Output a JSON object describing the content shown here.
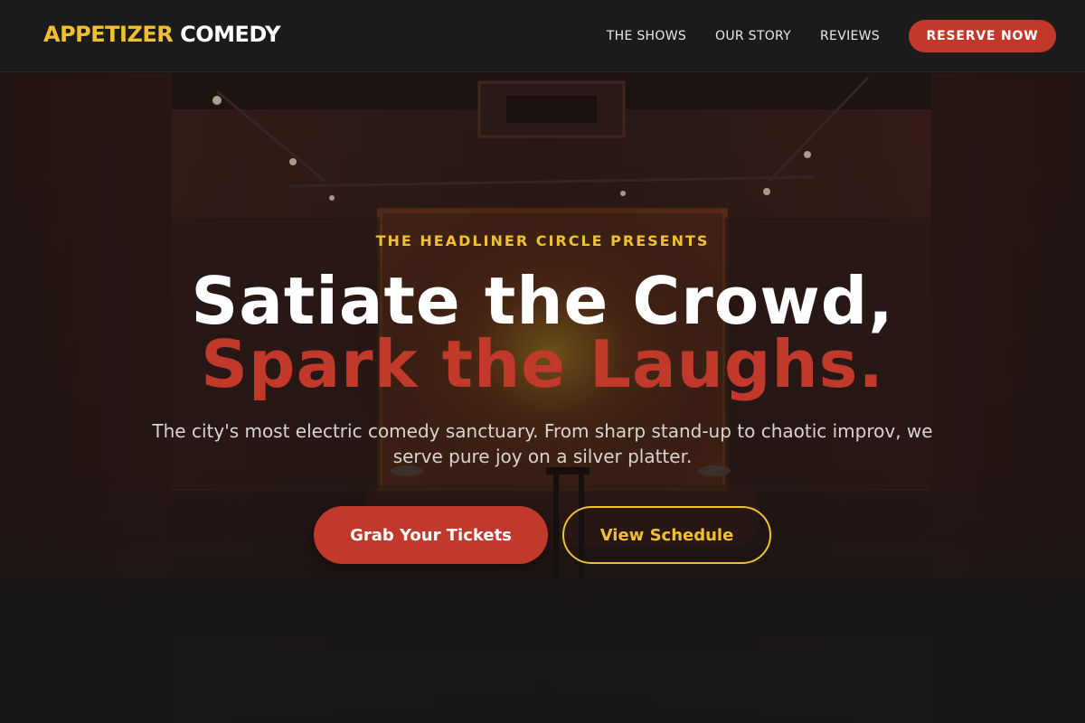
{
  "header": {
    "logo_part1": "APPETIZER",
    "logo_part2": "COMEDY",
    "nav": [
      "THE SHOWS",
      "OUR STORY",
      "REVIEWS"
    ],
    "cta": "RESERVE NOW"
  },
  "hero": {
    "eyebrow": "THE HEADLINER CIRCLE PRESENTS",
    "title_line1": "Satiate the Crowd,",
    "title_line2": "Spark the Laughs.",
    "subtitle": "The city's most electric comedy sanctuary. From sharp stand-up to chaotic improv, we serve pure joy on a silver platter.",
    "primary_button": "Grab Your Tickets",
    "secondary_button": "View Schedule",
    "background_image": "dark comedy club stage with spotlights"
  },
  "colors": {
    "brand_yellow": "#f0c030",
    "brand_red": "#c0392b",
    "header_bg": "#1b1b1b",
    "page_bg": "#161616"
  }
}
